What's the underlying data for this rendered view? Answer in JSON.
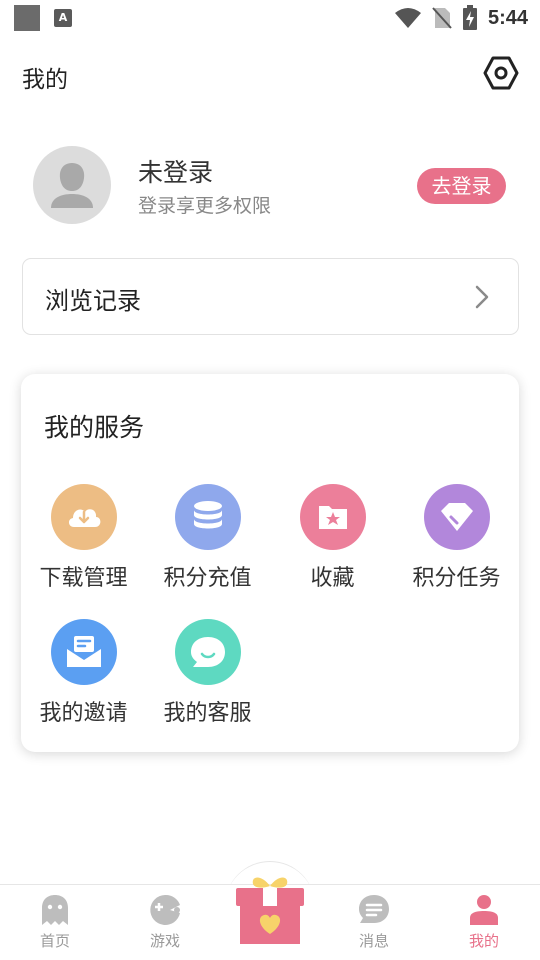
{
  "status_bar": {
    "time": "5:44",
    "notif_letter": "A"
  },
  "header": {
    "title": "我的"
  },
  "profile": {
    "name": "未登录",
    "subtitle": "登录享更多权限",
    "login_button": "去登录"
  },
  "history": {
    "label": "浏览记录"
  },
  "services": {
    "title": "我的服务",
    "items": [
      {
        "label": "下载管理",
        "icon": "cloud-download-icon",
        "color": "#edbd84"
      },
      {
        "label": "积分充值",
        "icon": "coins-stack-icon",
        "color": "#8fa8ec"
      },
      {
        "label": "收藏",
        "icon": "folder-star-icon",
        "color": "#ec7f9a"
      },
      {
        "label": "积分任务",
        "icon": "diamond-icon",
        "color": "#b287db"
      },
      {
        "label": "我的邀请",
        "icon": "envelope-icon",
        "color": "#5b9ff2"
      },
      {
        "label": "我的客服",
        "icon": "chat-bubble-icon",
        "color": "#5ed9c1"
      }
    ]
  },
  "bottom_nav": {
    "items": [
      {
        "label": "首页",
        "icon": "ghost-icon"
      },
      {
        "label": "游戏",
        "icon": "gamepad-icon"
      },
      {
        "label": "消息",
        "icon": "message-icon"
      },
      {
        "label": "我的",
        "icon": "person-icon"
      }
    ],
    "center_icon": "gift-box-icon",
    "active_color": "#e8718a",
    "inactive_color": "#bdbdbd"
  }
}
